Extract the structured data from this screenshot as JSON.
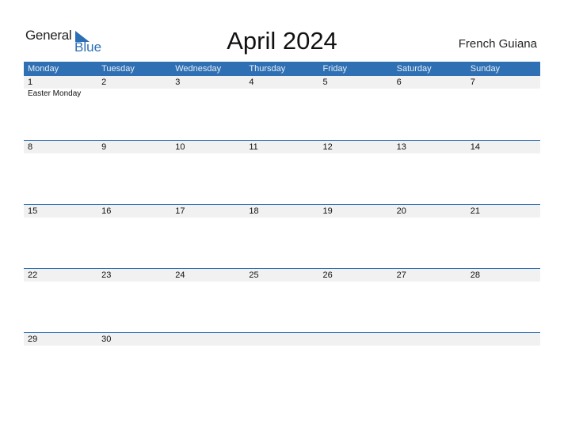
{
  "logo": {
    "text_general": "General",
    "text_blue": "Blue"
  },
  "title": "April 2024",
  "region": "French Guiana",
  "weekdays": [
    "Monday",
    "Tuesday",
    "Wednesday",
    "Thursday",
    "Friday",
    "Saturday",
    "Sunday"
  ],
  "weeks": [
    {
      "days": [
        "1",
        "2",
        "3",
        "4",
        "5",
        "6",
        "7"
      ],
      "events": [
        "Easter Monday",
        "",
        "",
        "",
        "",
        "",
        ""
      ]
    },
    {
      "days": [
        "8",
        "9",
        "10",
        "11",
        "12",
        "13",
        "14"
      ],
      "events": [
        "",
        "",
        "",
        "",
        "",
        "",
        ""
      ]
    },
    {
      "days": [
        "15",
        "16",
        "17",
        "18",
        "19",
        "20",
        "21"
      ],
      "events": [
        "",
        "",
        "",
        "",
        "",
        "",
        ""
      ]
    },
    {
      "days": [
        "22",
        "23",
        "24",
        "25",
        "26",
        "27",
        "28"
      ],
      "events": [
        "",
        "",
        "",
        "",
        "",
        "",
        ""
      ]
    },
    {
      "days": [
        "29",
        "30",
        "",
        "",
        "",
        "",
        ""
      ],
      "events": [
        "",
        "",
        "",
        "",
        "",
        "",
        ""
      ]
    }
  ],
  "colors": {
    "accent": "#2e70b3",
    "band": "#f1f1f1"
  }
}
